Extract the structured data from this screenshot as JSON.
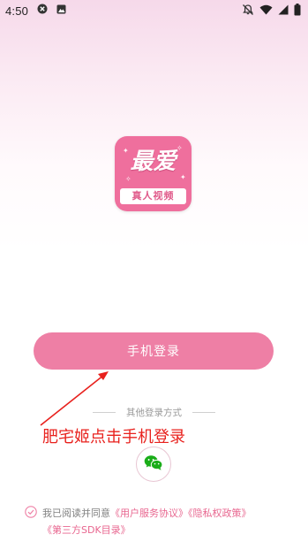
{
  "status_bar": {
    "time": "4:50"
  },
  "logo": {
    "title": "最爱",
    "subtitle": "真人视频"
  },
  "login": {
    "phone_login_label": "手机登录",
    "other_methods_label": "其他登录方式"
  },
  "annotation": {
    "text": "肥宅姬点击手机登录",
    "color": "#e8211d"
  },
  "agreement": {
    "prefix": "我已阅读并同意",
    "user_agreement": "《用户服务协议》",
    "privacy_policy": "《隐私权政策》",
    "third_party_sdk": "《第三方SDK目录》"
  },
  "colors": {
    "accent": "#ee7fa5",
    "logo_bg": "#ef6f9d",
    "link": "#e8668f",
    "wechat": "#1aad19"
  },
  "icons": [
    "media-close-icon",
    "gallery-icon",
    "mute-bell-icon",
    "wifi-icon",
    "signal-icon",
    "battery-icon",
    "wechat-icon",
    "check-circle-icon"
  ]
}
